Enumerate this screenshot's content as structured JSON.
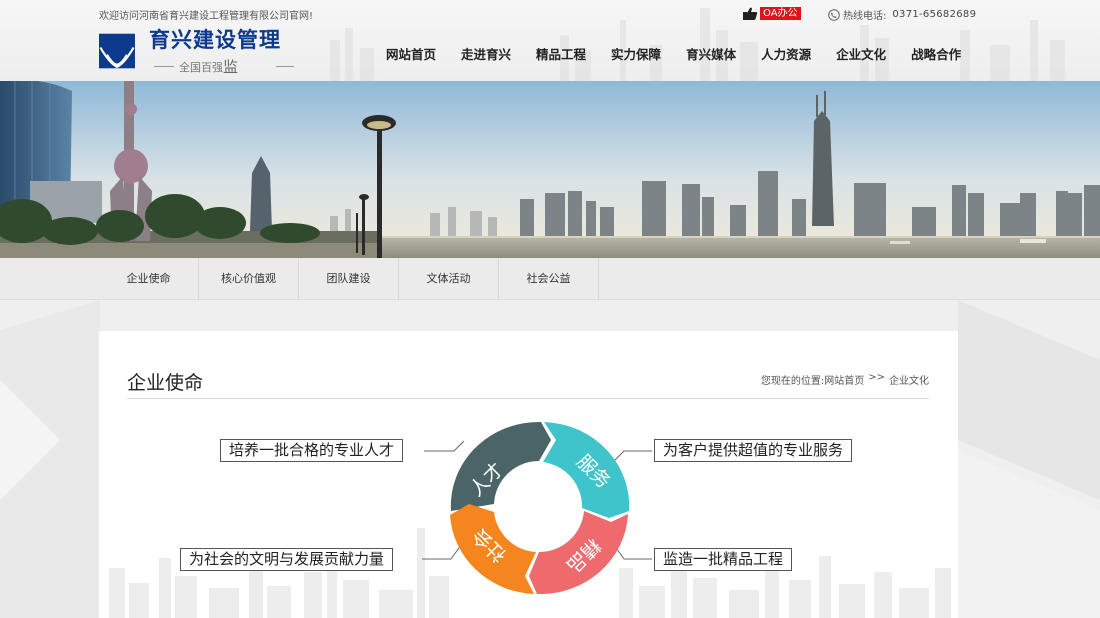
{
  "header": {
    "welcome": "欢迎访问河南省育兴建设工程管理有限公司官网!",
    "oa_label": "OA办公",
    "hotline_label": "热线电话:",
    "hotline_number": "0371-65682689",
    "logo_name": "育兴建设管理",
    "logo_slogan_small": "全国百强",
    "logo_slogan_big": "监"
  },
  "nav": {
    "items": [
      "网站首页",
      "走进育兴",
      "精品工程",
      "实力保障",
      "育兴媒体",
      "人力资源",
      "企业文化",
      "战略合作"
    ]
  },
  "subnav": {
    "items": [
      "企业使命",
      "核心价值观",
      "团队建设",
      "文体活动",
      "社会公益"
    ]
  },
  "content": {
    "page_title": "企业使命",
    "breadcrumb_prefix": "您现在的位置:",
    "breadcrumb_home": "网站首页",
    "breadcrumb_sep": ">>",
    "breadcrumb_current": "企业文化"
  },
  "mission": {
    "talent": "培养一批合格的专业人才",
    "service": "为客户提供超值的专业服务",
    "society": "为社会的文明与发展贡献力量",
    "quality": "监造一批精品工程",
    "wheel": {
      "talent": "人才",
      "service": "服务",
      "quality": "精品",
      "society": "社会"
    }
  },
  "colors": {
    "brand_blue": "#0d3a8c",
    "oa_red": "#d9161c",
    "wheel_talent": "#4a6468",
    "wheel_service": "#3fc4cc",
    "wheel_quality": "#ef6a6d",
    "wheel_society": "#f5861f"
  }
}
